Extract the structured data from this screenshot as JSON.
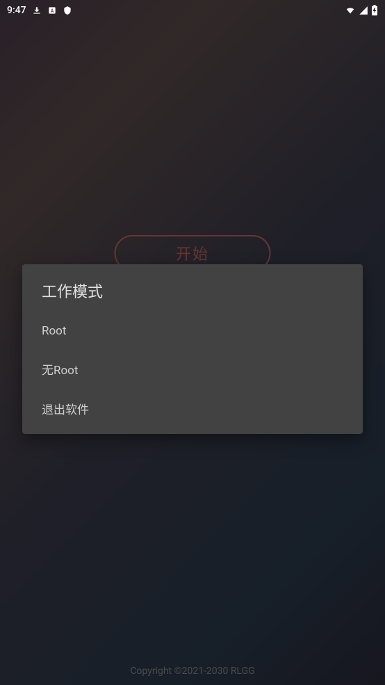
{
  "statusBar": {
    "time": "9:47"
  },
  "mainScreen": {
    "startButton": "开始",
    "copyright": "Copyright ©2021-2030 RLGG"
  },
  "dialog": {
    "title": "工作模式",
    "items": [
      {
        "label": "Root"
      },
      {
        "label": "无Root"
      },
      {
        "label": "退出软件"
      }
    ]
  }
}
